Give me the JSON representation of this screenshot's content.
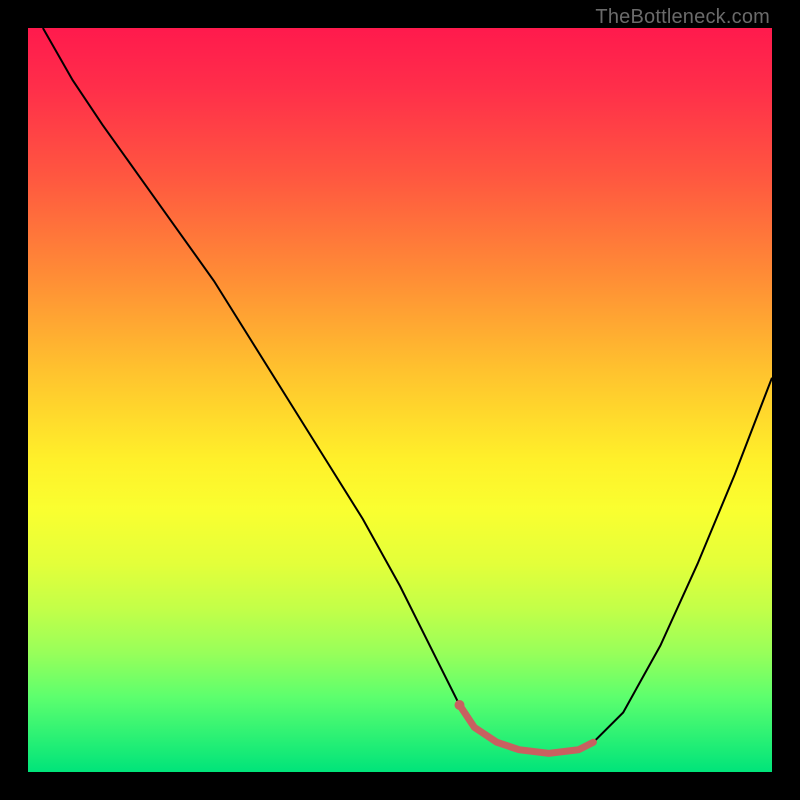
{
  "watermark": "TheBottleneck.com",
  "chart_data": {
    "type": "line",
    "title": "",
    "xlabel": "",
    "ylabel": "",
    "xlim": [
      0,
      100
    ],
    "ylim": [
      0,
      100
    ],
    "grid": false,
    "legend": false,
    "gradient": {
      "top_color": "#ff1a4d",
      "bottom_color": "#00e47a"
    },
    "series": [
      {
        "name": "curve",
        "x": [
          2,
          6,
          10,
          15,
          20,
          25,
          30,
          35,
          40,
          45,
          50,
          55,
          58,
          60,
          63,
          66,
          70,
          74,
          76,
          80,
          85,
          90,
          95,
          100
        ],
        "y": [
          100,
          93,
          87,
          80,
          73,
          66,
          58,
          50,
          42,
          34,
          25,
          15,
          9,
          6,
          4,
          3,
          2.5,
          3,
          4,
          8,
          17,
          28,
          40,
          53
        ]
      }
    ],
    "highlight": {
      "name": "low-band",
      "x": [
        58,
        60,
        63,
        66,
        70,
        74,
        76
      ],
      "y": [
        9,
        6,
        4,
        3,
        2.5,
        3,
        4
      ],
      "color": "#c86060"
    }
  }
}
